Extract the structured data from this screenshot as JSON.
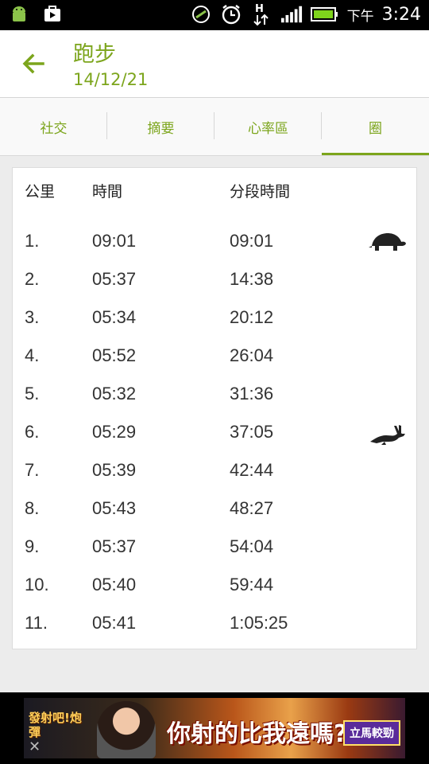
{
  "status_bar": {
    "ampm": "下午",
    "time": "3:24",
    "icons": [
      "android-icon",
      "play-store-icon",
      "data-sync-icon",
      "alarm-icon",
      "h-plus-network-icon",
      "signal-icon",
      "battery-icon"
    ]
  },
  "header": {
    "title": "跑步",
    "date": "14/12/21"
  },
  "tabs": [
    {
      "label": "社交"
    },
    {
      "label": "摘要"
    },
    {
      "label": "心率區"
    },
    {
      "label": "圈"
    }
  ],
  "laps": {
    "columns": [
      "公里",
      "時間",
      "分段時間"
    ],
    "rows": [
      {
        "km": "1.",
        "time": "09:01",
        "split": "09:01",
        "badge": "turtle-icon"
      },
      {
        "km": "2.",
        "time": "05:37",
        "split": "14:38"
      },
      {
        "km": "3.",
        "time": "05:34",
        "split": "20:12"
      },
      {
        "km": "4.",
        "time": "05:52",
        "split": "26:04"
      },
      {
        "km": "5.",
        "time": "05:32",
        "split": "31:36"
      },
      {
        "km": "6.",
        "time": "05:29",
        "split": "37:05",
        "badge": "rabbit-icon"
      },
      {
        "km": "7.",
        "time": "05:39",
        "split": "42:44"
      },
      {
        "km": "8.",
        "time": "05:43",
        "split": "48:27"
      },
      {
        "km": "9.",
        "time": "05:37",
        "split": "54:04"
      },
      {
        "km": "10.",
        "time": "05:40",
        "split": "59:44"
      },
      {
        "km": "11.",
        "time": "05:41",
        "split": "1:05:25"
      }
    ]
  },
  "ad": {
    "logo_text": "發射吧!炮彈",
    "headline": "你射的比我遠嗎?",
    "cta": "立馬較勁",
    "close": "✕"
  },
  "colors": {
    "accent": "#7ca51c",
    "background": "#ececec",
    "text": "#333333"
  }
}
